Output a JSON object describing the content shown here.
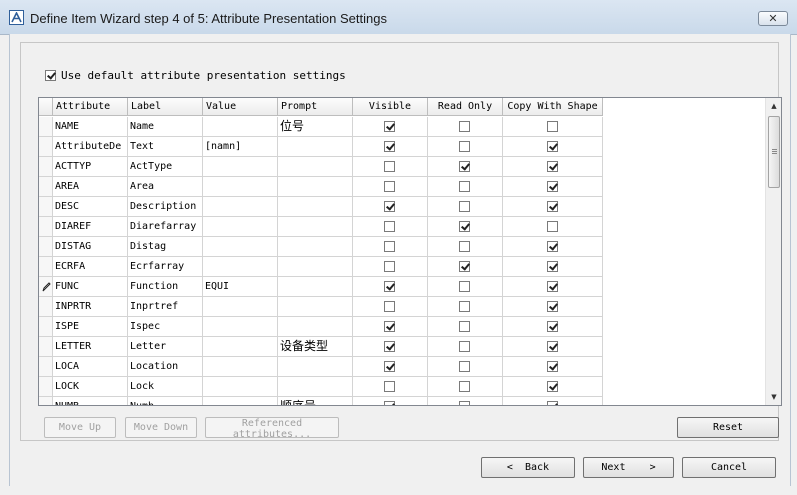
{
  "window": {
    "title": "Define Item Wizard step 4 of 5: Attribute Presentation Settings",
    "close_label": "✕"
  },
  "settings": {
    "use_default_label": "Use default attribute presentation settings",
    "use_default_checked": true
  },
  "grid": {
    "columns": [
      "Attribute",
      "Label",
      "Value",
      "Prompt",
      "Visible",
      "Read Only",
      "Copy With Shape"
    ],
    "rows": [
      {
        "attribute": "NAME",
        "label": "Name",
        "value": "",
        "prompt": "位号",
        "visible": true,
        "read_only": false,
        "copy_with_shape": false
      },
      {
        "attribute": "AttributeDe",
        "label": "Text",
        "value": "[namn]",
        "prompt": "",
        "visible": true,
        "read_only": false,
        "copy_with_shape": true
      },
      {
        "attribute": "ACTTYP",
        "label": "ActType",
        "value": "",
        "prompt": "",
        "visible": false,
        "read_only": true,
        "copy_with_shape": true
      },
      {
        "attribute": "AREA",
        "label": "Area",
        "value": "",
        "prompt": "",
        "visible": false,
        "read_only": false,
        "copy_with_shape": true
      },
      {
        "attribute": "DESC",
        "label": "Description",
        "value": "",
        "prompt": "",
        "visible": true,
        "read_only": false,
        "copy_with_shape": true
      },
      {
        "attribute": "DIAREF",
        "label": "Diarefarray",
        "value": "",
        "prompt": "",
        "visible": false,
        "read_only": true,
        "copy_with_shape": false
      },
      {
        "attribute": "DISTAG",
        "label": "Distag",
        "value": "",
        "prompt": "",
        "visible": false,
        "read_only": false,
        "copy_with_shape": true
      },
      {
        "attribute": "ECRFA",
        "label": "Ecrfarray",
        "value": "",
        "prompt": "",
        "visible": false,
        "read_only": true,
        "copy_with_shape": true
      },
      {
        "attribute": "FUNC",
        "label": "Function",
        "value": "EQUI",
        "prompt": "",
        "visible": true,
        "read_only": false,
        "copy_with_shape": true,
        "editing": true
      },
      {
        "attribute": "INPRTR",
        "label": "Inprtref",
        "value": "",
        "prompt": "",
        "visible": false,
        "read_only": false,
        "copy_with_shape": true
      },
      {
        "attribute": "ISPE",
        "label": "Ispec",
        "value": "",
        "prompt": "",
        "visible": true,
        "read_only": false,
        "copy_with_shape": true
      },
      {
        "attribute": "LETTER",
        "label": "Letter",
        "value": "",
        "prompt": "设备类型",
        "visible": true,
        "read_only": false,
        "copy_with_shape": true
      },
      {
        "attribute": "LOCA",
        "label": "Location",
        "value": "",
        "prompt": "",
        "visible": true,
        "read_only": false,
        "copy_with_shape": true
      },
      {
        "attribute": "LOCK",
        "label": "Lock",
        "value": "",
        "prompt": "",
        "visible": false,
        "read_only": false,
        "copy_with_shape": true
      },
      {
        "attribute": "NUMB",
        "label": "Numb",
        "value": "",
        "prompt": "顺序号",
        "visible": true,
        "read_only": false,
        "copy_with_shape": true
      }
    ]
  },
  "buttons": {
    "move_up": "Move Up",
    "move_down": "Move Down",
    "referenced_line1": "Referenced",
    "referenced_line2": "attributes...",
    "reset": "Reset",
    "back": "Back",
    "next": "Next",
    "cancel": "Cancel"
  },
  "icons": {
    "app": "app-logo-icon",
    "close": "close-icon",
    "edit_row": "pencil-icon",
    "scroll_up": "scroll-up-arrow-icon",
    "scroll_down": "scroll-down-arrow-icon",
    "back": "chevron-left-icon",
    "next": "chevron-right-icon"
  }
}
